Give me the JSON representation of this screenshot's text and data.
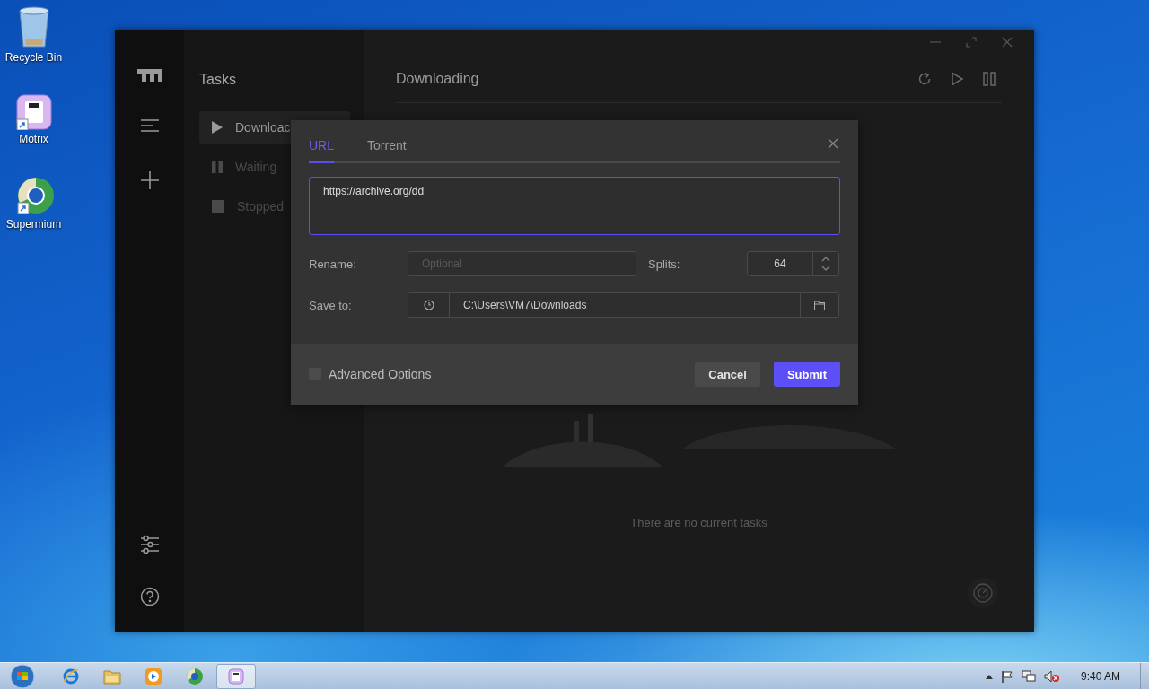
{
  "desktop_icons": [
    {
      "label": "Recycle Bin",
      "kind": "bin"
    },
    {
      "label": "Motrix",
      "kind": "motrix"
    },
    {
      "label": "Supermium",
      "kind": "browser"
    }
  ],
  "app": {
    "tasks_title": "Tasks",
    "task_filters": [
      {
        "label": "Downloac",
        "kind": "play",
        "selected": true
      },
      {
        "label": "Waiting",
        "kind": "pause",
        "selected": false
      },
      {
        "label": "Stopped",
        "kind": "stop",
        "selected": false
      }
    ],
    "main_title": "Downloading",
    "empty_message": "There are no current tasks"
  },
  "dialog": {
    "tabs": [
      {
        "label": "URL",
        "selected": true
      },
      {
        "label": "Torrent",
        "selected": false
      }
    ],
    "url_value": "https://archive.org/dd",
    "rename": {
      "label": "Rename:",
      "placeholder": "Optional"
    },
    "splits": {
      "label": "Splits:",
      "value": "64"
    },
    "save_to": {
      "label": "Save to:",
      "value": "C:\\Users\\VM7\\Downloads"
    },
    "advanced": {
      "label": "Advanced Options",
      "checked": false
    },
    "cancel": "Cancel",
    "submit": "Submit"
  },
  "taskbar": {
    "apps": [
      {
        "kind": "ie",
        "selected": false
      },
      {
        "kind": "folder",
        "selected": false
      },
      {
        "kind": "media",
        "selected": false
      },
      {
        "kind": "browser",
        "selected": false
      },
      {
        "kind": "motrix",
        "selected": true
      }
    ],
    "clock": "9:40 AM"
  }
}
